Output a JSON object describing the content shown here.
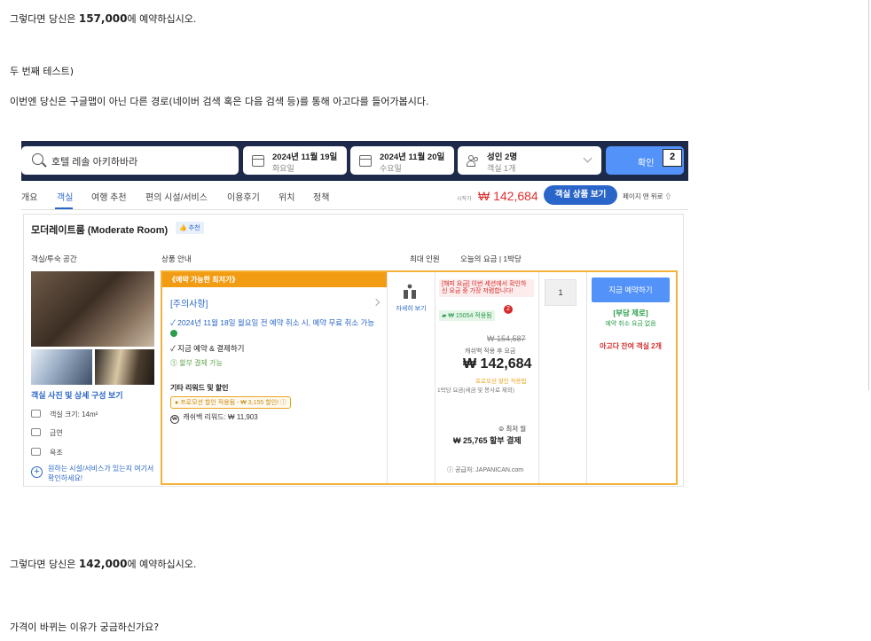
{
  "article": {
    "p1_pre": "그렇다면 당신은 ",
    "p1_price": "157,000",
    "p1_post": "에 예약하십시오.",
    "p2": "두 번째 테스트)",
    "p3": "이번엔 당신은 구글맵이 아닌 다른 경로(네이버 검색 혹은 다음 검색 등)를 통해 아고다를 들어가봅시다.",
    "p4_pre": "그렇다면 당신은 ",
    "p4_price": "142,000",
    "p4_post": "에 예약하십시오.",
    "p5": "가격이 바뀌는 이유가 궁금하신가요?"
  },
  "screenshot": {
    "search": {
      "hotel": "호텔 레솔 아키하바라",
      "checkin": "2024년 11월 19일",
      "checkin_day": "화요일",
      "checkout": "2024년 11월 20일",
      "checkout_day": "수요일",
      "guests": "성인 2명",
      "rooms": "객실 1개",
      "confirm": "확인",
      "step_marker": "2"
    },
    "nav": {
      "tabs": [
        "개요",
        "객실",
        "여행 추천",
        "편의 시설/서비스",
        "이용후기",
        "위치",
        "정책"
      ],
      "from_label": "시작가",
      "price": "₩ 142,684",
      "view_rooms": "객실 상품 보기",
      "to_top": "페이지 맨 위로"
    },
    "room": {
      "title": "모더레이트룸 (Moderate Room)",
      "recommend": "추천",
      "columns": [
        "객실/투숙 공간",
        "상품 안내",
        "최대 인원",
        "오늘의 요금 | 1박당"
      ],
      "photo_link": "객실 사진 및 상세 구성 보기",
      "features": [
        "객실 크기: 14m²",
        "금연",
        "욕조"
      ],
      "more_link": "원하는 시설/서비스가 있는지 여기서 확인하세요!"
    },
    "offer": {
      "header": "《예약 가능한 최저가》",
      "notice": "[주의사항]",
      "cancel_policy": "2024년 11월 18일 월요일 전 예약 취소 시, 예약 무료 취소 가능",
      "pay_now": "지금 예약 & 결제하기",
      "partial_pay": "할부 결제 가능",
      "other_title": "기타 리워드 및 할인",
      "promo": "프로모션 할인 적용됨 - ₩ 3,155 할인!",
      "cashback": "캐쉬백 리워드: ₩ 11,903",
      "guest_details": "자세히 보기",
      "warning": "[해피 요금] 이번 세션에서 확인하신 요금 중 가장 저렴합니다!",
      "warning_count": "2",
      "applied": "₩ 15054 적용됨",
      "original_price": "₩ 154,587",
      "after_cashback": "캐쉬백 적용 후 요금",
      "final_price": "₩ 142,684",
      "promo_applied": "프로모션 할인 적용됨",
      "tax_note": "1박당 요금(세금 및 봉사료 제외)",
      "min_month": "최저 월",
      "installment": "₩ 25,765 할부 결제",
      "supplier": "공급처: JAPANICAN.com",
      "qty": "1",
      "book_now": "지금 예약하기",
      "free_cancel": "[부담 제로]",
      "no_cancel_fee": "예약 취소 요금 없음",
      "rooms_left": "아고다 잔여 객실 2개"
    }
  },
  "colors": {
    "navy": "#1e2a4a",
    "agoda_blue": "#5392f9",
    "link_blue": "#2a66c9",
    "price_red": "#e12d2d",
    "orange": "#f29c14",
    "green": "#2c9d4b"
  }
}
